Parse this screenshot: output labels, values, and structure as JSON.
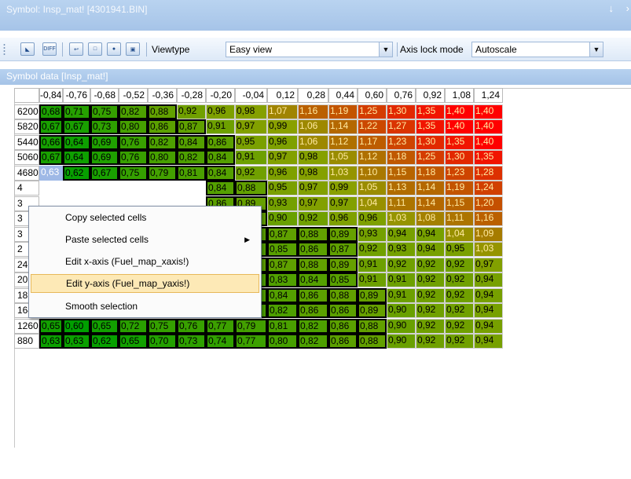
{
  "window": {
    "title": "Symbol: Insp_mat! [4301941.BIN]",
    "pin_icon": "pin-icon",
    "close_icon": "close-icon"
  },
  "toolbar": {
    "icons": [
      "graph-icon",
      "diff-icon",
      "import-icon",
      "export-icon",
      "undo-icon",
      "window-icon"
    ],
    "icon_texts": [
      "",
      "DIFF",
      "",
      "",
      "",
      ""
    ],
    "viewtype_label": "Viewtype",
    "viewtype_value": "Easy view",
    "axislock_label": "Axis lock mode",
    "axislock_value": "Autoscale"
  },
  "panel": {
    "title": "Symbol data [Insp_mat!]"
  },
  "grid": {
    "x_axis": [
      "-0,84",
      "-0,76",
      "-0,68",
      "-0,52",
      "-0,36",
      "-0,28",
      "-0,20",
      "-0,04",
      "0,12",
      "0,28",
      "0,44",
      "0,60",
      "0,76",
      "0,92",
      "1,08",
      "1,24"
    ],
    "rows": [
      {
        "y": "6200",
        "values": [
          "0,68",
          "0,71",
          "0,75",
          "0,82",
          "0,88",
          "0,92",
          "0,96",
          "0,98",
          "1,07",
          "1,16",
          "1,19",
          "1,25",
          "1,30",
          "1,35",
          "1,40",
          "1,40"
        ]
      },
      {
        "y": "5820",
        "values": [
          "0,67",
          "0,67",
          "0,73",
          "0,80",
          "0,86",
          "0,87",
          "0,91",
          "0,97",
          "0,99",
          "1,06",
          "1,14",
          "1,22",
          "1,27",
          "1,35",
          "1,40",
          "1,40"
        ]
      },
      {
        "y": "5440",
        "values": [
          "0,66",
          "0,64",
          "0,69",
          "0,76",
          "0,82",
          "0,84",
          "0,86",
          "0,95",
          "0,96",
          "1,06",
          "1,12",
          "1,17",
          "1,23",
          "1,30",
          "1,35",
          "1,40"
        ]
      },
      {
        "y": "5060",
        "values": [
          "0,67",
          "0,64",
          "0,69",
          "0,76",
          "0,80",
          "0,82",
          "0,84",
          "0,91",
          "0,97",
          "0,98",
          "1,05",
          "1,12",
          "1,18",
          "1,25",
          "1,30",
          "1,35"
        ]
      },
      {
        "y": "4680",
        "values": [
          "0,63",
          "0,62",
          "0,67",
          "0,75",
          "0,79",
          "0,81",
          "0,84",
          "0,92",
          "0,96",
          "0,98",
          "1,03",
          "1,10",
          "1,15",
          "1,18",
          "1,23",
          "1,28"
        ]
      },
      {
        "y": "4",
        "values": [
          "",
          "",
          "",
          "",
          "",
          "",
          "0,84",
          "0,88",
          "0,95",
          "0,97",
          "0,99",
          "1,05",
          "1,13",
          "1,14",
          "1,19",
          "1,24"
        ]
      },
      {
        "y": "3",
        "values": [
          "",
          "",
          "",
          "",
          "",
          "",
          "0,86",
          "0,89",
          "0,93",
          "0,97",
          "0,97",
          "1,04",
          "1,11",
          "1,14",
          "1,15",
          "1,20"
        ]
      },
      {
        "y": "3",
        "values": [
          "",
          "",
          "",
          "",
          "",
          "",
          "0,85",
          "0,88",
          "0,90",
          "0,92",
          "0,96",
          "0,96",
          "1,03",
          "1,08",
          "1,11",
          "1,16"
        ]
      },
      {
        "y": "3",
        "values": [
          "",
          "",
          "",
          "",
          "",
          "",
          "0,82",
          "0,85",
          "0,87",
          "0,88",
          "0,89",
          "0,93",
          "0,94",
          "0,94",
          "1,04",
          "1,09"
        ]
      },
      {
        "y": "2",
        "values": [
          "",
          "",
          "",
          "",
          "",
          "",
          "0,81",
          "0,83",
          "0,85",
          "0,86",
          "0,87",
          "0,92",
          "0,93",
          "0,94",
          "0,95",
          "1,03"
        ]
      },
      {
        "y": "2400",
        "values": [
          "0,68",
          "0,65",
          "0,72",
          "0,76",
          "0,81",
          "0,83",
          "0,84",
          "0,86",
          "0,87",
          "0,88",
          "0,89",
          "0,91",
          "0,92",
          "0,92",
          "0,92",
          "0,97"
        ]
      },
      {
        "y": "2020",
        "values": [
          "0,66",
          "0,62",
          "0,69",
          "0,73",
          "0,78",
          "0,79",
          "0,80",
          "0,82",
          "0,83",
          "0,84",
          "0,85",
          "0,91",
          "0,91",
          "0,92",
          "0,92",
          "0,94"
        ]
      },
      {
        "y": "1830",
        "values": [
          "0,68",
          "0,65",
          "0,70",
          "0,75",
          "0,78",
          "0,80",
          "0,81",
          "0,83",
          "0,84",
          "0,86",
          "0,88",
          "0,89",
          "0,91",
          "0,92",
          "0,92",
          "0,94"
        ]
      },
      {
        "y": "1640",
        "values": [
          "0,65",
          "0,60",
          "0,67",
          "0,73",
          "0,77",
          "0,78",
          "0,79",
          "0,81",
          "0,82",
          "0,86",
          "0,86",
          "0,89",
          "0,90",
          "0,92",
          "0,92",
          "0,94"
        ]
      },
      {
        "y": "1260",
        "values": [
          "0,65",
          "0,60",
          "0,65",
          "0,72",
          "0,75",
          "0,76",
          "0,77",
          "0,79",
          "0,81",
          "0,82",
          "0,86",
          "0,88",
          "0,90",
          "0,92",
          "0,92",
          "0,94"
        ]
      },
      {
        "y": "880",
        "values": [
          "0,63",
          "0,63",
          "0,62",
          "0,65",
          "0,70",
          "0,73",
          "0,74",
          "0,77",
          "0,80",
          "0,82",
          "0,86",
          "0,88",
          "0,90",
          "0,92",
          "0,92",
          "0,94"
        ]
      }
    ],
    "selected_cell": "4680 / -0,84",
    "color_low": "#00a000",
    "color_mid": "#8ba000",
    "color_high": "#ff0000"
  },
  "context_menu": {
    "items": [
      {
        "label": "Copy selected cells",
        "name": "ctx-copy-cells"
      },
      {
        "label": "Paste selected cells",
        "name": "ctx-paste-cells",
        "submenu_icon": "submenu-arrow-icon"
      },
      {
        "label": "Edit x-axis (Fuel_map_xaxis!)",
        "name": "ctx-edit-x-axis"
      },
      {
        "label": "Edit y-axis (Fuel_map_yaxis!)",
        "name": "ctx-edit-y-axis"
      },
      {
        "label": "Smooth selection",
        "name": "ctx-smooth-selection"
      }
    ],
    "highlighted_index": 3
  }
}
